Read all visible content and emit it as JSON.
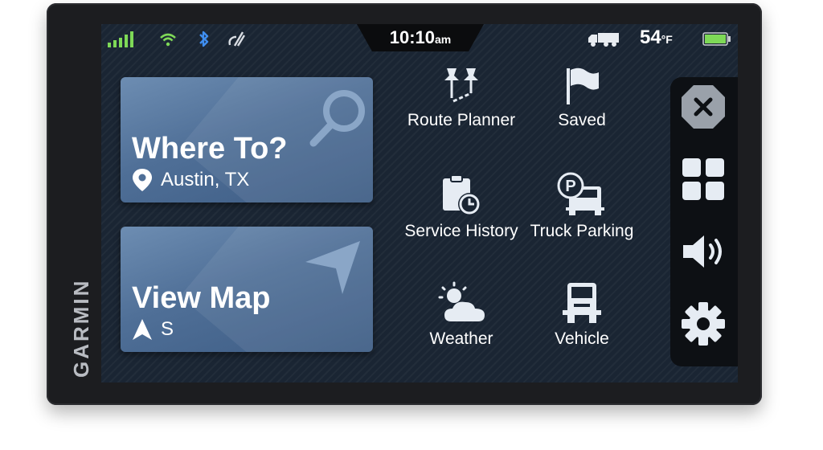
{
  "device": {
    "brand": "GARMIN"
  },
  "status": {
    "time": "10:10",
    "time_suffix": "am",
    "temperature": "54",
    "temperature_unit": "°F",
    "battery_color": "#7ed957",
    "icons": [
      "signal-icon",
      "wifi-icon",
      "bluetooth-icon",
      "drive-link-icon",
      "truck-icon",
      "battery-icon"
    ]
  },
  "tiles": {
    "where_to": {
      "title": "Where To?",
      "location": "Austin, TX"
    },
    "view_map": {
      "title": "View Map",
      "heading": "S"
    }
  },
  "menu": {
    "route_planner": "Route Planner",
    "saved": "Saved",
    "service_history": "Service History",
    "truck_parking": "Truck Parking",
    "weather": "Weather",
    "vehicle": "Vehicle"
  },
  "sidebar": [
    "close-icon",
    "apps-grid-icon",
    "volume-icon",
    "settings-gear-icon"
  ],
  "colors": {
    "accent": "#5b7ba3",
    "screen_bg": "#1a2533",
    "icon_white": "#e6ecf3"
  }
}
